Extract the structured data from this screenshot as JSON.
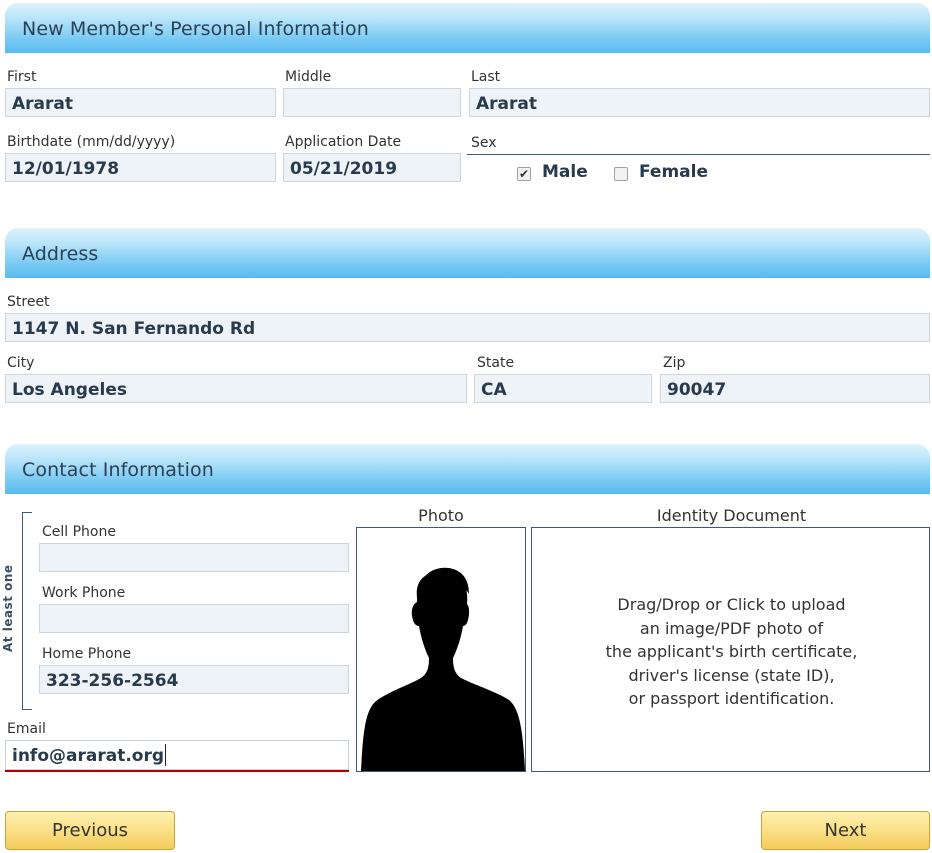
{
  "personal": {
    "header": "New Member's Personal Information",
    "first": {
      "label": "First",
      "value": "Ararat"
    },
    "middle": {
      "label": "Middle",
      "value": ""
    },
    "last": {
      "label": "Last",
      "value": "Ararat"
    },
    "birthdate": {
      "label": "Birthdate (mm/dd/yyyy)",
      "value": "12/01/1978"
    },
    "app_date": {
      "label": "Application Date",
      "value": "05/21/2019"
    },
    "sex": {
      "label": "Sex",
      "options": [
        {
          "label": "Male",
          "checked": true
        },
        {
          "label": "Female",
          "checked": false
        }
      ]
    }
  },
  "address": {
    "header": "Address",
    "street": {
      "label": "Street",
      "value": "1147 N. San Fernando Rd"
    },
    "city": {
      "label": "City",
      "value": "Los Angeles"
    },
    "state": {
      "label": "State",
      "value": "CA"
    },
    "zip": {
      "label": "Zip",
      "value": "90047"
    }
  },
  "contact": {
    "header": "Contact Information",
    "at_least_one": "At least one",
    "cell": {
      "label": "Cell Phone",
      "value": ""
    },
    "work": {
      "label": "Work Phone",
      "value": ""
    },
    "home": {
      "label": "Home Phone",
      "value": "323-256-2564"
    },
    "email": {
      "label": "Email",
      "value": "info@ararat.org"
    },
    "photo_title": "Photo",
    "identity_title": "Identity Document",
    "upload_lines": [
      "Drag/Drop or Click to upload",
      "an image/PDF photo of",
      "the applicant's birth certificate,",
      "driver's license (state ID),",
      "or passport identification."
    ]
  },
  "nav": {
    "previous": "Previous",
    "next": "Next"
  },
  "colors": {
    "header_gradient_bottom": "#58bbef",
    "field_bg": "#eef3f8",
    "button_gold": "#f4cb5c",
    "email_focus_underline": "#b30000"
  }
}
